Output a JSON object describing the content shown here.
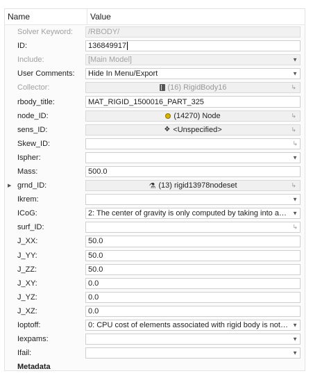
{
  "header": {
    "name": "Name",
    "value": "Value"
  },
  "rows": {
    "solver_keyword": {
      "label": "Solver Keyword:",
      "value": "/RBODY/"
    },
    "id": {
      "label": "ID:",
      "value": "136849917"
    },
    "include": {
      "label": "Include:",
      "value": "[Main Model]"
    },
    "user_comments": {
      "label": "User Comments:",
      "value": "Hide In Menu/Export"
    },
    "collector": {
      "label": "Collector:",
      "value": "(16) RigidBody16",
      "icon": "rigidbody-book-icon"
    },
    "rbody_title": {
      "label": "rbody_title:",
      "value": "MAT_RIGID_1500016_PART_325"
    },
    "node_id": {
      "label": "node_ID:",
      "value": "(14270) Node",
      "icon": "node-icon"
    },
    "sens_id": {
      "label": "sens_ID:",
      "value": "<Unspecified>",
      "icon": "sensor-icon"
    },
    "skew_id": {
      "label": "Skew_ID:",
      "value": ""
    },
    "ispher": {
      "label": "Ispher:",
      "value": ""
    },
    "mass": {
      "label": "Mass:",
      "value": "500.0"
    },
    "grnd_id": {
      "label": "grnd_ID:",
      "value": "(13) rigid13978nodeset",
      "icon": "nodeset-icon"
    },
    "ikrem": {
      "label": "Ikrem:",
      "value": ""
    },
    "icog": {
      "label": "ICoG:",
      "value": "2: The center of gravity is only computed by taking into acco..."
    },
    "surf_id": {
      "label": "surf_ID:",
      "value": ""
    },
    "j_xx": {
      "label": "J_XX:",
      "value": "50.0"
    },
    "j_yy": {
      "label": "J_YY:",
      "value": "50.0"
    },
    "j_zz": {
      "label": "J_ZZ:",
      "value": "50.0"
    },
    "j_xy": {
      "label": "J_XY:",
      "value": "0.0"
    },
    "j_yz": {
      "label": "J_YZ:",
      "value": "0.0"
    },
    "j_xz": {
      "label": "J_XZ:",
      "value": "0.0"
    },
    "ioptoff": {
      "label": "Ioptoff:",
      "value": "0: CPU cost of elements associated with rigid body is not tak..."
    },
    "iexpams": {
      "label": "Iexpams:",
      "value": ""
    },
    "ifail": {
      "label": "Ifail:",
      "value": ""
    }
  },
  "metadata": {
    "label": "Metadata"
  }
}
